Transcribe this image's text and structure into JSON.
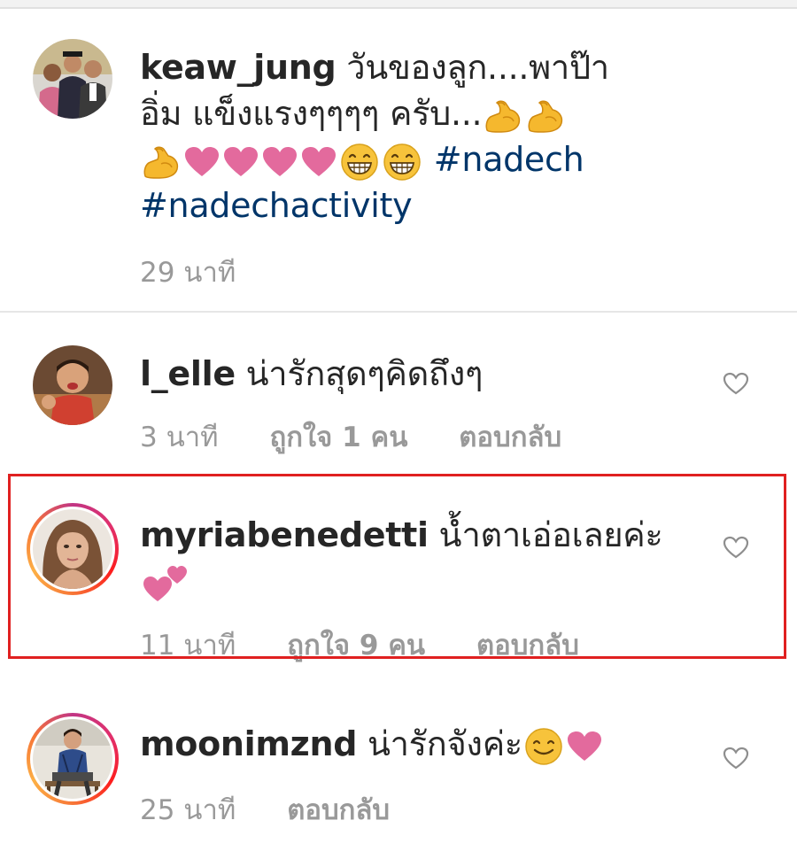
{
  "comments": [
    {
      "username": "keaw_jung",
      "text_line1": "วันของลูก....พาป๊า",
      "text_line2": "อิ่ม แข็งแรงๆๆๆๆ ครับ...",
      "hashtag1": "#nadech",
      "hashtag2": "#nadechactivity",
      "time": "29 นาที"
    },
    {
      "username": "l_elle",
      "text": "น่ารักสุดๆคิดถึงๆ",
      "time": "3 นาที",
      "likes": "ถูกใจ 1 คน",
      "reply": "ตอบกลับ"
    },
    {
      "username": "myriabenedetti",
      "text": "น้ำตาเอ่อเลยค่ะ",
      "time": "11 นาที",
      "likes": "ถูกใจ 9 คน",
      "reply": "ตอบกลับ"
    },
    {
      "username": "moonimznd",
      "text": "น่ารักจังค่ะ",
      "time": "25 นาที",
      "reply": "ตอบกลับ"
    }
  ],
  "icons": {
    "like": "heart-outline-icon",
    "muscle": "flexed-biceps-icon",
    "heart": "pink-heart-icon",
    "grin": "grinning-face-icon",
    "smile": "smiling-face-icon",
    "two_hearts": "two-hearts-icon"
  },
  "colors": {
    "hashtag": "#003569",
    "meta": "#999999",
    "highlight": "#e02020",
    "heart": "#e36a9d"
  }
}
